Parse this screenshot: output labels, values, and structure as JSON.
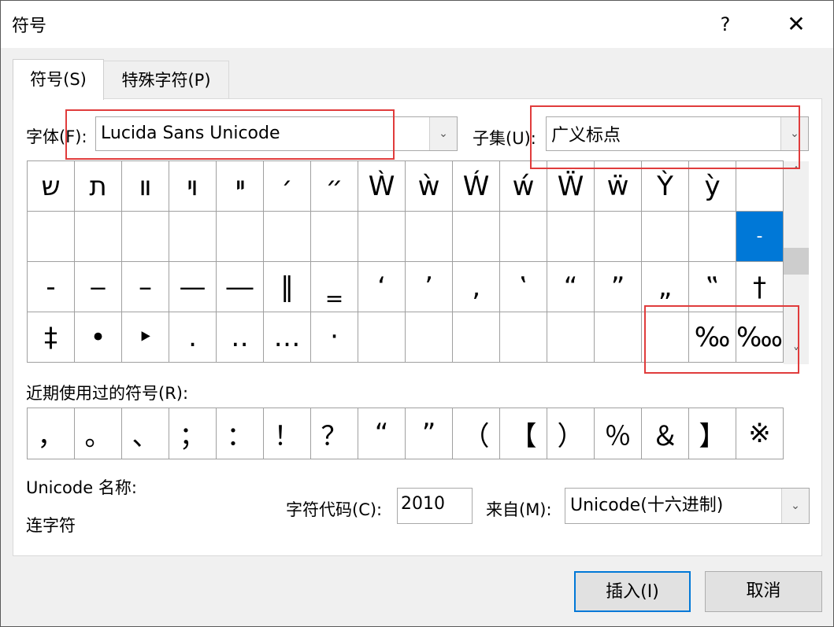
{
  "window": {
    "title": "符号",
    "help": "?",
    "close": "✕"
  },
  "tabs": [
    {
      "label": "符号(S)"
    },
    {
      "label": "特殊字符(P)"
    }
  ],
  "font": {
    "label": "字体(F):",
    "value": "Lucida Sans Unicode"
  },
  "subset": {
    "label": "子集(U):",
    "value": "广义标点"
  },
  "symbol_grid": [
    [
      "ש",
      "ת",
      "װ",
      "ױ",
      "ײ",
      "׳",
      "״",
      "Ẁ",
      "ẁ",
      "Ẃ",
      "ẃ",
      "Ẅ",
      "ẅ",
      "Ỳ",
      "ỳ",
      ""
    ],
    [
      "",
      "",
      "",
      "",
      "",
      "",
      "",
      "",
      "",
      "",
      "",
      "",
      "",
      "",
      "",
      "-"
    ],
    [
      "‐",
      "‒",
      "–",
      "—",
      "―",
      "‖",
      "‗",
      "‘",
      "’",
      "‚",
      "‛",
      "“",
      "”",
      "„",
      "‟",
      "†"
    ],
    [
      "‡",
      "•",
      "‣",
      "․",
      "‥",
      "…",
      "‧",
      "",
      "",
      "",
      "",
      "",
      "",
      "",
      "‰",
      "‱"
    ]
  ],
  "scrollbar": {
    "up": "˄",
    "down": "˅"
  },
  "recent": {
    "label": "近期使用过的符号(R):",
    "symbols": [
      "，",
      "。",
      "、",
      "；",
      "：",
      "！",
      "？",
      "“",
      "”",
      "（",
      "【",
      "）",
      "％",
      "＆",
      "】",
      "※"
    ]
  },
  "unicode_name": {
    "label": "Unicode 名称:",
    "value": "连字符"
  },
  "char_code": {
    "label": "字符代码(C):",
    "value": "2010"
  },
  "from": {
    "label": "来自(M):",
    "value": "Unicode(十六进制)"
  },
  "buttons": {
    "insert": "插入(I)",
    "cancel": "取消"
  },
  "colors": {
    "selection": "#0078d7",
    "highlight": "#e03c3c"
  }
}
